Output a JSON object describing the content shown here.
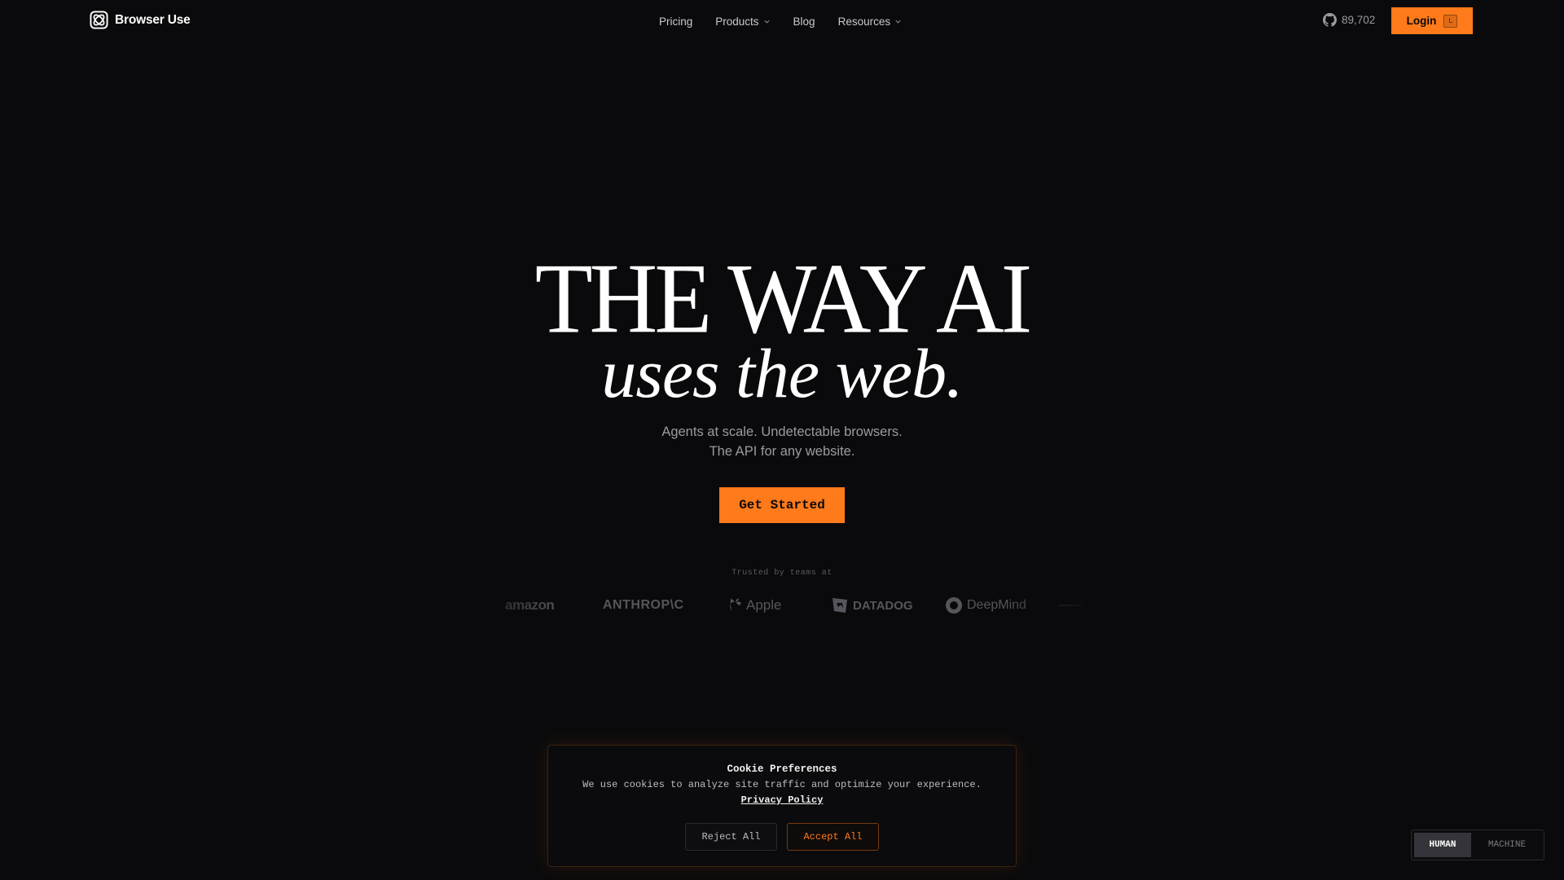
{
  "header": {
    "logo_text": "Browser Use",
    "nav": [
      {
        "label": "Pricing",
        "has_dropdown": false
      },
      {
        "label": "Products",
        "has_dropdown": true
      },
      {
        "label": "Blog",
        "has_dropdown": false
      },
      {
        "label": "Resources",
        "has_dropdown": true
      }
    ],
    "github_stars": "89,702",
    "login_label": "Login",
    "login_shortcut": "L"
  },
  "hero": {
    "title_line1": "THE WAY AI",
    "title_line2": "uses the web.",
    "subtitle_line1": "Agents at scale. Undetectable browsers.",
    "subtitle_line2": "The API for any website.",
    "cta_label": "Get Started"
  },
  "trusted": {
    "label": "Trusted by teams at",
    "brands": [
      "amazon",
      "ANTHROP\\C",
      "Apple",
      "DATADOG",
      "DeepMind"
    ]
  },
  "cookie": {
    "title": "Cookie Preferences",
    "text": "We use cookies to analyze site traffic and optimize your experience.",
    "link_label": "Privacy Policy",
    "reject_label": "Reject All",
    "accept_label": "Accept All"
  },
  "mode_toggle": {
    "options": [
      "HUMAN",
      "MACHINE"
    ],
    "selected": "HUMAN"
  },
  "colors": {
    "background": "#0a0a0c",
    "accent": "#ff7a1a",
    "muted_text": "#9a9aa2"
  }
}
